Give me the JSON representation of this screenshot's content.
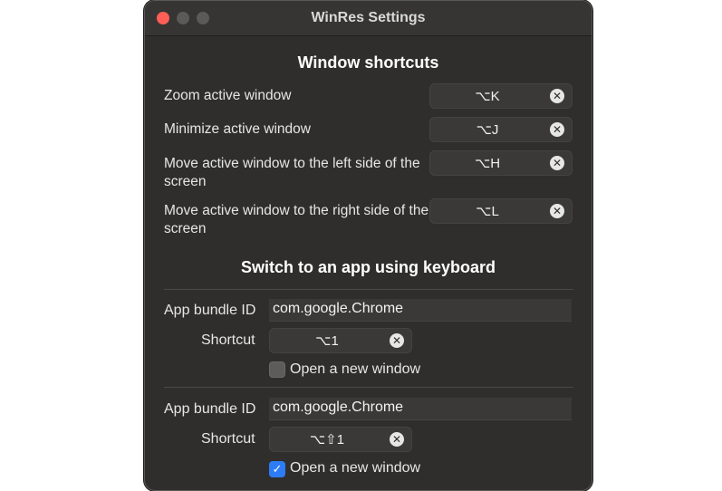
{
  "window": {
    "title": "WinRes Settings"
  },
  "window_shortcuts": {
    "title": "Window shortcuts",
    "rows": [
      {
        "label": "Zoom active window",
        "shortcut": "⌥K"
      },
      {
        "label": "Minimize active window",
        "shortcut": "⌥J"
      },
      {
        "label": "Move active window to the left side of the screen",
        "shortcut": "⌥H"
      },
      {
        "label": "Move active window to the right side of the screen",
        "shortcut": "⌥L"
      }
    ]
  },
  "app_switch": {
    "title": "Switch to an app using keyboard",
    "bundle_label": "App bundle ID",
    "shortcut_label": "Shortcut",
    "checkbox_label": "Open a new window",
    "entries": [
      {
        "bundle_id": "com.google.Chrome",
        "shortcut": "⌥1",
        "open_new_window": false
      },
      {
        "bundle_id": "com.google.Chrome",
        "shortcut": "⌥⇧1",
        "open_new_window": true
      }
    ]
  },
  "icons": {
    "clear": "clear-x-icon",
    "check": "checkmark-icon"
  },
  "colors": {
    "close": "#ff5f57",
    "accent": "#2d7cf6",
    "background": "#2f2e2d"
  }
}
